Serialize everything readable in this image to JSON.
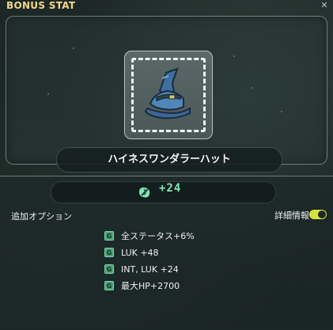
{
  "window": {
    "title": "BONUS STAT",
    "close_label": "✕"
  },
  "item": {
    "name": "ハイネスワンダラーハット",
    "icon": "wizard-hat-icon"
  },
  "bonus": {
    "value": "+24",
    "icon": "stat-leaf-icon",
    "value_color": "#7fe7b6"
  },
  "options": {
    "section_label": "追加オプション",
    "detail_label": "詳細情報",
    "detail_toggle_on": true,
    "grade_letter": "G",
    "lines": [
      {
        "text": "全ステータス+6%"
      },
      {
        "text": "LUK  +48"
      },
      {
        "text": "INT, LUK  +24"
      },
      {
        "text": "最大HP+2700"
      }
    ]
  },
  "colors": {
    "title": "#f1d98a",
    "toggle_on": "#d7e33c",
    "grade_badge": "#4aa37a"
  }
}
